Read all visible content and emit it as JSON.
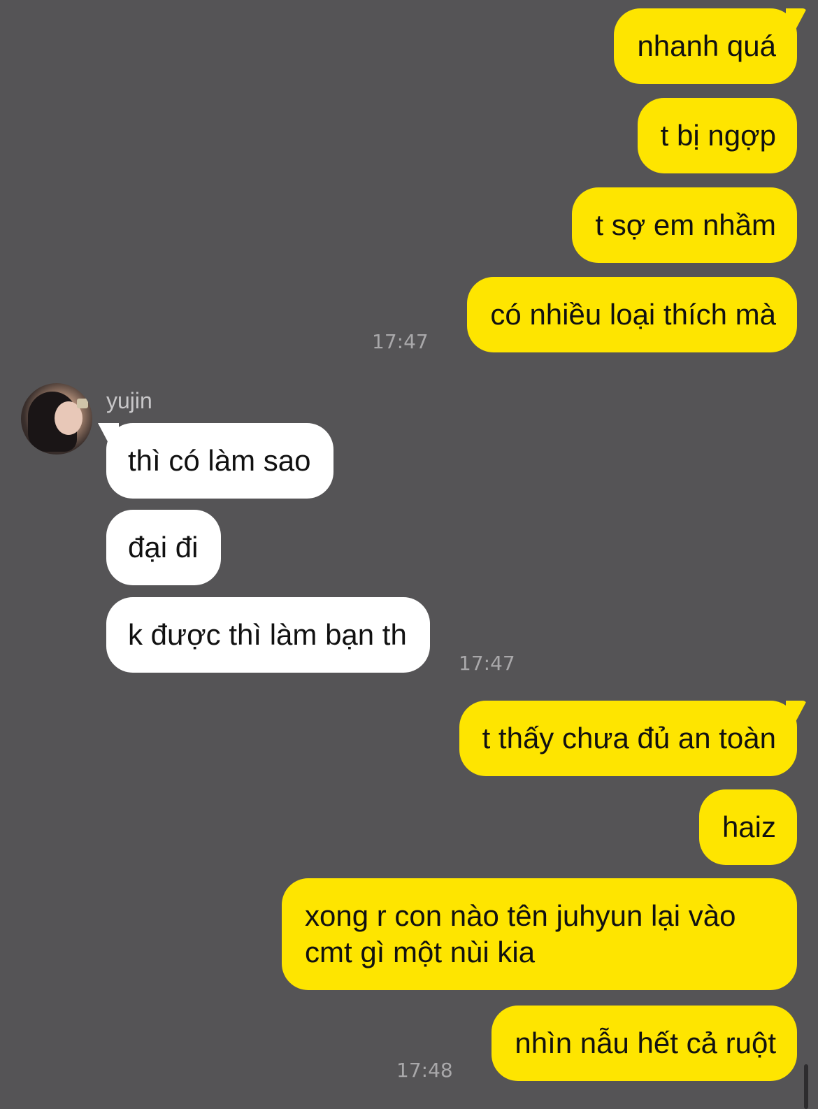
{
  "conversation": {
    "contact_name": "yujin",
    "messages": [
      {
        "side": "sent",
        "text": "nhanh quá"
      },
      {
        "side": "sent",
        "text": "t bị ngợp"
      },
      {
        "side": "sent",
        "text": "t sợ em nhầm"
      },
      {
        "side": "sent",
        "text": "có nhiều loại thích mà",
        "time": "17:47"
      },
      {
        "side": "received",
        "text": "thì có làm sao"
      },
      {
        "side": "received",
        "text": "đại đi"
      },
      {
        "side": "received",
        "text": "k được thì làm bạn th",
        "time": "17:47"
      },
      {
        "side": "sent",
        "text": "t thấy chưa đủ an toàn"
      },
      {
        "side": "sent",
        "text": "haiz"
      },
      {
        "side": "sent",
        "text": "xong r con nào tên juhyun lại vào cmt gì một nùi kia"
      },
      {
        "side": "sent",
        "text": "nhìn nẫu hết cả ruột",
        "time": "17:48"
      }
    ]
  },
  "colors": {
    "background": "#555456",
    "sent_bubble": "#fee500",
    "received_bubble": "#ffffff",
    "timestamp": "#a9a8aa"
  },
  "icons": {
    "avatar": "profile-photo"
  }
}
